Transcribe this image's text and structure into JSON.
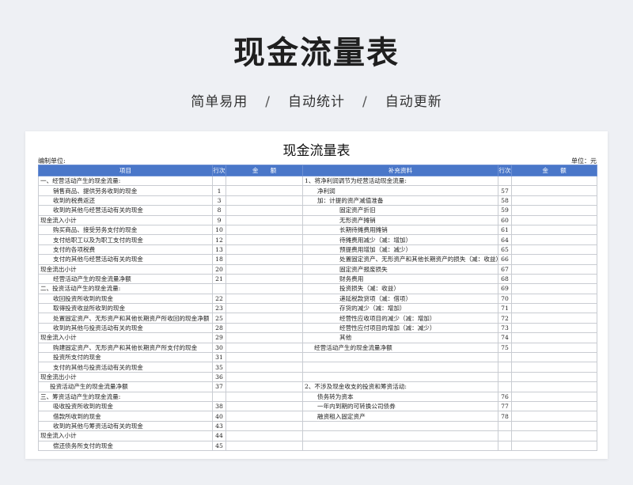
{
  "hero": {
    "title": "现金流量表",
    "subtitle": [
      "简单易用",
      "/",
      "自动统计",
      "/",
      "自动更新"
    ]
  },
  "sheet": {
    "title": "现金流量表",
    "prepared_by_label": "编制单位:",
    "unit_label": "单位：元",
    "headers": {
      "left_item": "项目",
      "left_line": "行次",
      "left_amount": "金　　额",
      "right_item": "补充资料",
      "right_line": "行次",
      "right_amount": "金　　额"
    },
    "rows": [
      {
        "l": "一、经营活动产生的现金流量:",
        "ln": "",
        "li": 0,
        "r": "1、将净利润调节为经营活动现金流量:",
        "rn": "",
        "ri": 0
      },
      {
        "l": "销售商品、提供劳务收到的现金",
        "ln": "1",
        "li": 2,
        "r": "净利润",
        "rn": "57",
        "ri": 2
      },
      {
        "l": "收到的税费返还",
        "ln": "3",
        "li": 2,
        "r": "加：计提的资产减值准备",
        "rn": "58",
        "ri": 2
      },
      {
        "l": "收到的其他与经营活动有关的现金",
        "ln": "8",
        "li": 2,
        "r": "固定资产折旧",
        "rn": "59",
        "ri": 4
      },
      {
        "l": "现金流入小计",
        "ln": "9",
        "li": 0,
        "r": "无形资产摊销",
        "rn": "60",
        "ri": 4
      },
      {
        "l": "购买商品、接受劳务支付的现金",
        "ln": "10",
        "li": 2,
        "r": "长期待摊费用摊销",
        "rn": "61",
        "ri": 4
      },
      {
        "l": "支付给职工以及为职工支付的现金",
        "ln": "12",
        "li": 2,
        "r": "待摊费用减少（减：增加）",
        "rn": "64",
        "ri": 4
      },
      {
        "l": "支付的各项税费",
        "ln": "13",
        "li": 2,
        "r": "预提费用增加（减：减少）",
        "rn": "65",
        "ri": 4
      },
      {
        "l": "支付的其他与经营活动有关的现金",
        "ln": "18",
        "li": 2,
        "r": "处置固定资产、无形资产和其他长期资产的损失（减：收益）",
        "rn": "66",
        "ri": 4
      },
      {
        "l": "现金流出小计",
        "ln": "20",
        "li": 0,
        "r": "固定资产报废损失",
        "rn": "67",
        "ri": 4
      },
      {
        "l": "经营活动产生的现金流量净额",
        "ln": "21",
        "li": 2,
        "r": "财务费用",
        "rn": "68",
        "ri": 4
      },
      {
        "l": "二、投资活动产生的现金流量:",
        "ln": "",
        "li": 0,
        "r": "投资损失（减：收益）",
        "rn": "69",
        "ri": 4
      },
      {
        "l": "收回投资所收到的现金",
        "ln": "22",
        "li": 2,
        "r": "递延税款贷项（减：借项）",
        "rn": "70",
        "ri": 4
      },
      {
        "l": "取得投资收益所收到的现金",
        "ln": "23",
        "li": 2,
        "r": "存货的减少（减：增加）",
        "rn": "71",
        "ri": 4
      },
      {
        "l": "处置固定资产、无形资产和其他长期资产所收回的现金净额",
        "ln": "25",
        "li": 2,
        "r": "经营性应收项目的减少（减：增加）",
        "rn": "72",
        "ri": 4
      },
      {
        "l": "收到的其他与投资活动有关的现金",
        "ln": "28",
        "li": 2,
        "r": "经营性应付项目的增加（减：减少）",
        "rn": "73",
        "ri": 4
      },
      {
        "l": "现金流入小计",
        "ln": "29",
        "li": 0,
        "r": "其他",
        "rn": "74",
        "ri": 4
      },
      {
        "l": "购建固定资产、无形资产和其他长期资产所支付的现金",
        "ln": "30",
        "li": 2,
        "r": "经营活动产生的现金流量净额",
        "rn": "75",
        "ri": 1
      },
      {
        "l": "投资所支付的现金",
        "ln": "31",
        "li": 2,
        "r": "",
        "rn": "",
        "ri": 0
      },
      {
        "l": "支付的其他与投资活动有关的现金",
        "ln": "35",
        "li": 2,
        "r": "",
        "rn": "",
        "ri": 0
      },
      {
        "l": "现金流出小计",
        "ln": "36",
        "li": 0,
        "r": "",
        "rn": "",
        "ri": 0
      },
      {
        "l": "投资活动产生的现金流量净额",
        "ln": "37",
        "li": 1,
        "r": "2、不涉及现金收支的投资和筹资活动:",
        "rn": "",
        "ri": 0
      },
      {
        "l": "三、筹资活动产生的现金流量:",
        "ln": "",
        "li": 0,
        "r": "债务转为资本",
        "rn": "76",
        "ri": 2
      },
      {
        "l": "吸收投资所收到的现金",
        "ln": "38",
        "li": 2,
        "r": "一年内到期的可转换公司债券",
        "rn": "77",
        "ri": 2
      },
      {
        "l": "借款所收到的现金",
        "ln": "40",
        "li": 2,
        "r": "融资租入固定资产",
        "rn": "78",
        "ri": 2
      },
      {
        "l": "收到的其他与筹资活动有关的现金",
        "ln": "43",
        "li": 2,
        "r": "",
        "rn": "",
        "ri": 0
      },
      {
        "l": "现金流入小计",
        "ln": "44",
        "li": 0,
        "r": "",
        "rn": "",
        "ri": 0
      },
      {
        "l": "偿还债务所支付的现金",
        "ln": "45",
        "li": 2,
        "r": "",
        "rn": "",
        "ri": 0
      }
    ]
  }
}
